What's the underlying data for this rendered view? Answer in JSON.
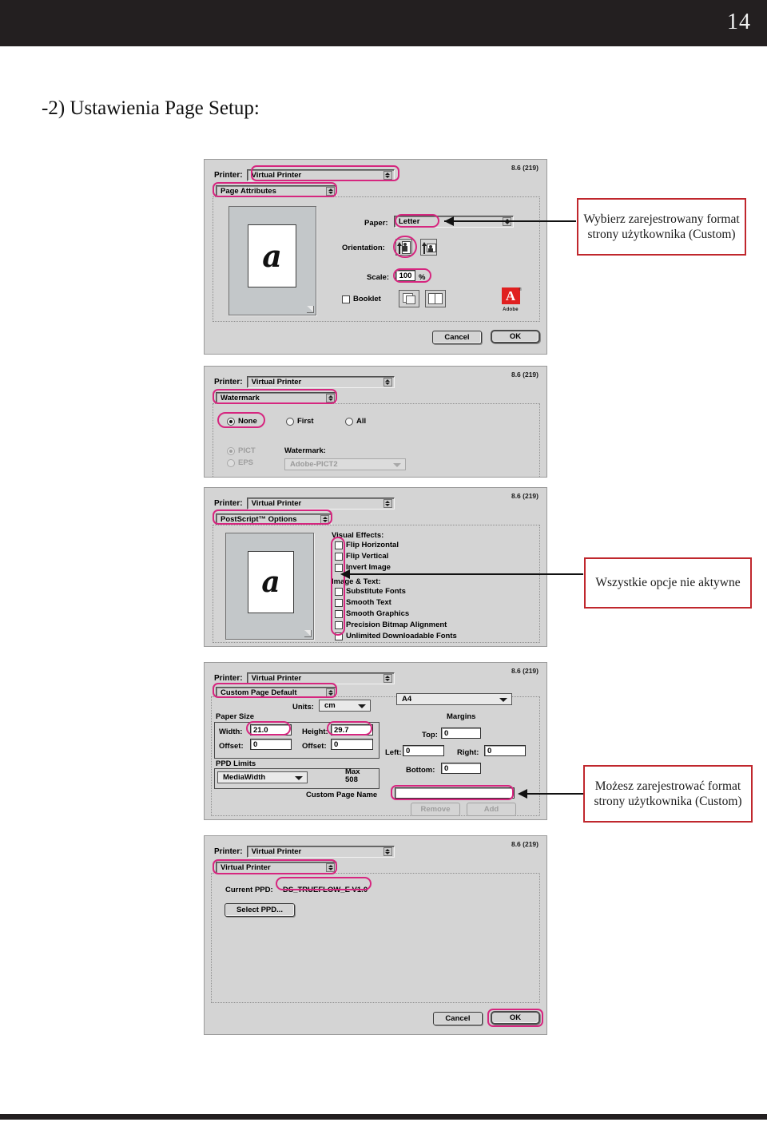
{
  "page": {
    "number": "14",
    "section_title": "-2) Ustawienia Page Setup:"
  },
  "common": {
    "printer_label": "Printer:",
    "printer_value": "Virtual Printer",
    "version": "8.6 (219)",
    "cancel": "Cancel",
    "ok": "OK"
  },
  "panel_page_attributes": {
    "pane_menu": "Page Attributes",
    "paper_label": "Paper:",
    "paper_value": "Letter",
    "orientation_label": "Orientation:",
    "scale_label": "Scale:",
    "scale_value": "100",
    "percent": "%",
    "booklet_label": "Booklet",
    "preview_glyph": "a",
    "adobe_wordmark": "Adobe",
    "adobe_letter": "A"
  },
  "panel_watermark": {
    "pane_menu": "Watermark",
    "radio_none": "None",
    "radio_first": "First",
    "radio_all": "All",
    "radio_pict": "PICT",
    "radio_eps": "EPS",
    "watermark_label": "Watermark:",
    "watermark_value": "Adobe-PICT2"
  },
  "panel_postscript": {
    "pane_menu": "PostScript™ Options",
    "group_visual": "Visual Effects:",
    "group_imagetext": "Image & Text:",
    "visual_effects": [
      "Flip Horizontal",
      "Flip Vertical",
      "Invert Image"
    ],
    "image_text": [
      "Substitute Fonts",
      "Smooth Text",
      "Smooth Graphics",
      "Precision Bitmap Alignment",
      "Unlimited Downloadable Fonts"
    ],
    "preview_glyph": "a"
  },
  "panel_custom_page": {
    "pane_menu": "Custom Page Default",
    "preset_value": "A4",
    "units_label": "Units:",
    "units_value": "cm",
    "paper_size_label": "Paper Size",
    "width_label": "Width:",
    "width_value": "21.0",
    "height_label": "Height:",
    "height_value": "29.7",
    "offset_label_left": "Offset:",
    "offset_value_left": "0",
    "offset_label_right": "Offset:",
    "offset_value_right": "0",
    "ppd_limits_label": "PPD Limits",
    "ppd_limits_value": "MediaWidth",
    "max_label": "Max",
    "max_value": "508",
    "margins_label": "Margins",
    "top_label": "Top:",
    "top_value": "0",
    "left_label": "Left:",
    "left_value": "0",
    "right_label": "Right:",
    "right_value": "0",
    "bottom_label": "Bottom:",
    "bottom_value": "0",
    "custom_page_name_label": "Custom Page Name",
    "custom_page_name_value": "",
    "remove_button": "Remove",
    "add_button": "Add"
  },
  "panel_virtual_printer": {
    "pane_menu": "Virtual Printer",
    "current_ppd_label": "Current PPD:",
    "current_ppd_value": "DS_TRUEFLOW_E V1.0",
    "select_ppd_button": "Select PPD..."
  },
  "callouts": {
    "one": "Wybierz zarejestrowany format strony użytkownika (Custom)",
    "two": "Wszystkie opcje nie aktywne",
    "three": "Możesz zarejestrować format strony użytkownika (Custom)"
  },
  "colors": {
    "highlight": "#d6267f",
    "callout_border": "#c0272d",
    "header_bar": "#231f20",
    "adobe_red": "#e02020",
    "dialog_bg": "#d4d4d4"
  }
}
